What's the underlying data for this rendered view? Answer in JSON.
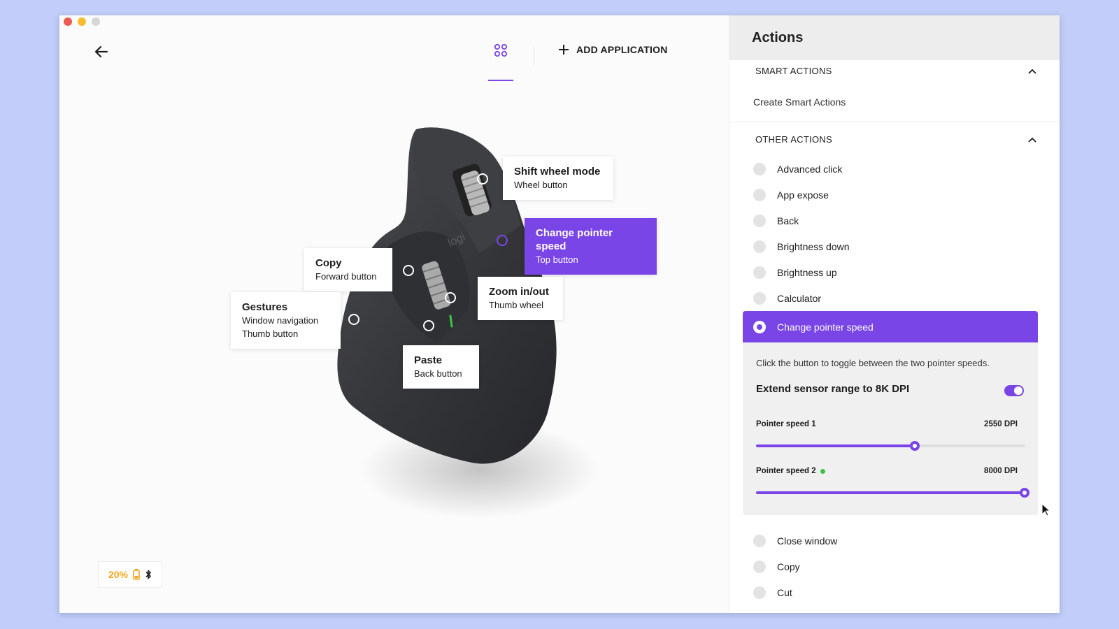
{
  "header": {
    "add_application_label": "ADD APPLICATION"
  },
  "callouts": [
    {
      "title": "Shift wheel mode",
      "subtitle": "Wheel button"
    },
    {
      "title": "Change pointer speed",
      "subtitle": "Top button"
    },
    {
      "title": "Copy",
      "subtitle": "Forward button"
    },
    {
      "title": "Zoom in/out",
      "subtitle": "Thumb wheel"
    },
    {
      "title": "Gestures",
      "subtitle": "Window navigation",
      "subtitle2": "Thumb button"
    },
    {
      "title": "Paste",
      "subtitle": "Back button"
    }
  ],
  "device_status": {
    "battery_percent": "20%",
    "battery_color": "#f2a51b",
    "connection_icon": "bluetooth-icon"
  },
  "panel": {
    "title": "Actions",
    "smart_actions": {
      "heading": "SMART ACTIONS",
      "link": "Create Smart Actions"
    },
    "other_actions": {
      "heading": "OTHER ACTIONS",
      "items_before": [
        "Advanced click",
        "App expose",
        "Back",
        "Brightness down",
        "Brightness up",
        "Calculator"
      ],
      "selected": "Change pointer speed",
      "items_after": [
        "Close window",
        "Copy",
        "Cut"
      ]
    },
    "detail": {
      "description": "Click the button to toggle between the two pointer speeds.",
      "extend_label": "Extend sensor range to 8K DPI",
      "extend_enabled": true,
      "speed1": {
        "label": "Pointer speed 1",
        "value": "2550 DPI",
        "fraction": 0.59
      },
      "speed2": {
        "label": "Pointer speed 2",
        "value": "8000 DPI",
        "fraction": 1.0
      }
    }
  },
  "colors": {
    "accent": "#7a45e6",
    "background": "#c2cdf9"
  }
}
